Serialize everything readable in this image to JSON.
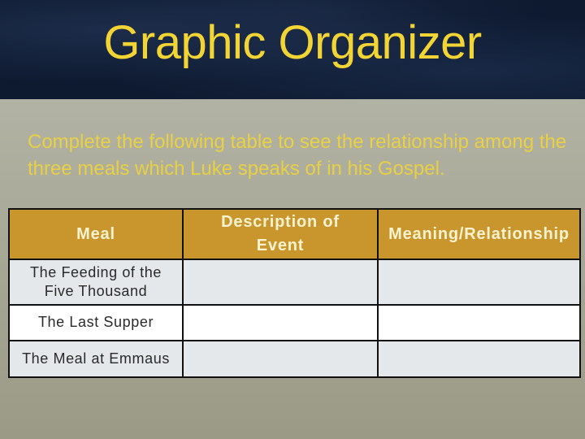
{
  "slide": {
    "title": "Graphic Organizer",
    "intro": "Complete the following table to see the relationship among the three meals which Luke speaks of in his Gospel."
  },
  "colors": {
    "title_band": "#0e1a30",
    "title_text": "#f2d534",
    "header_fill": "#c9962e",
    "header_text": "#fbf3d0",
    "body_text": "#2a2a2a",
    "row_shaded": "#e4e8ea",
    "row_plain": "#ffffff"
  },
  "table": {
    "headers": [
      "Meal",
      "Description of Event",
      "Meaning/Relationship"
    ],
    "rows": [
      {
        "meal": "The Feeding of the Five Thousand",
        "description": "",
        "meaning": ""
      },
      {
        "meal": "The Last Supper",
        "description": "",
        "meaning": ""
      },
      {
        "meal": "The Meal at Emmaus",
        "description": "",
        "meaning": ""
      }
    ]
  }
}
